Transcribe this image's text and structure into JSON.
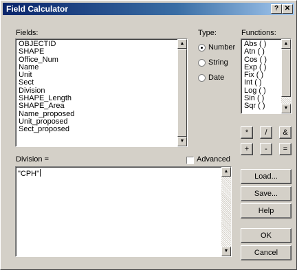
{
  "window": {
    "title": "Field Calculator",
    "help_btn": "?",
    "close_btn": "✕"
  },
  "fields": {
    "label": "Fields:",
    "items": [
      "OBJECTID",
      "SHAPE",
      "Office_Num",
      "Name",
      "Unit",
      "Sect",
      "Division",
      "SHAPE_Length",
      "SHAPE_Area",
      "Name_proposed",
      "Unit_proposed",
      "Sect_proposed"
    ]
  },
  "type": {
    "label": "Type:",
    "options": [
      "Number",
      "String",
      "Date"
    ],
    "selected": "Number"
  },
  "functions": {
    "label": "Functions:",
    "items": [
      "Abs ( )",
      "Atn ( )",
      "Cos ( )",
      "Exp ( )",
      "Fix ( )",
      "Int ( )",
      "Log ( )",
      "Sin ( )",
      "Sqr ( )"
    ]
  },
  "operators": [
    "*",
    "/",
    "&",
    "+",
    "-",
    "="
  ],
  "expression": {
    "label": "Division =",
    "value": "\"CPH\""
  },
  "advanced": {
    "label": "Advanced",
    "checked": false
  },
  "buttons": {
    "load": "Load...",
    "save": "Save...",
    "help": "Help",
    "ok": "OK",
    "cancel": "Cancel"
  }
}
